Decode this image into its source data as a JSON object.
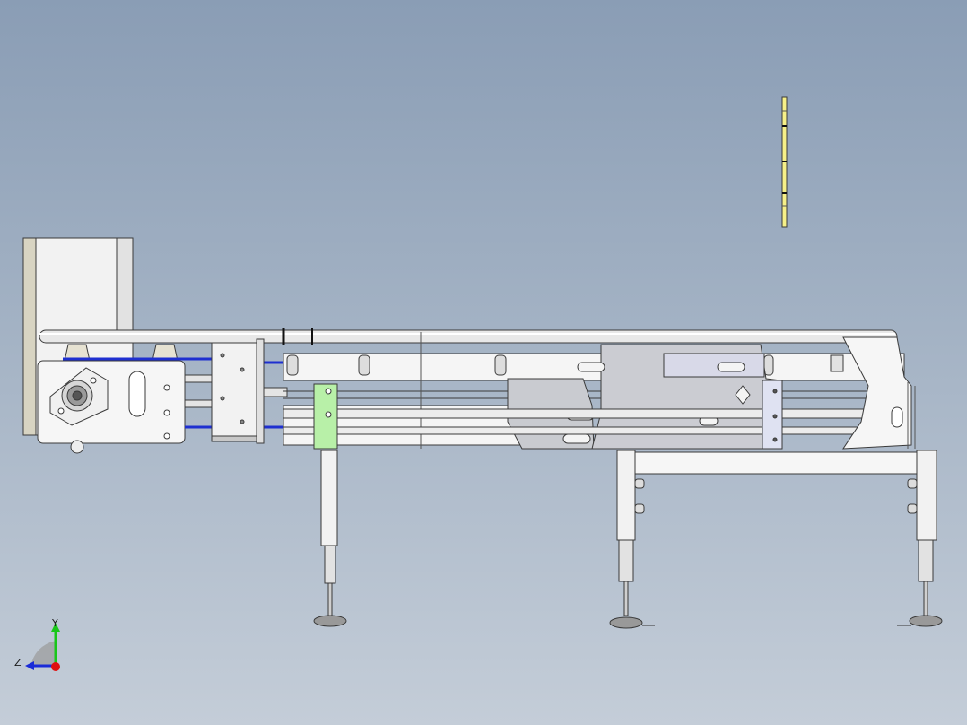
{
  "viewport": {
    "background_top": "#8a9db5",
    "background_bottom": "#c4cdd8"
  },
  "triad": {
    "y_label": "Y",
    "z_label": "Z",
    "y_color": "#19c619",
    "z_color": "#1a2bd8",
    "x_color": "#e01010"
  },
  "model": {
    "part_fill": "#f4f4f4",
    "part_stroke": "#3a3a3a",
    "shaded_plate": "#c9cbd0",
    "tube_fill": "#e6e6e6",
    "highlight_green": "#b8f0a8",
    "highlight_yellow": "#f6f088",
    "accent_blue": "#1e2fd0"
  }
}
